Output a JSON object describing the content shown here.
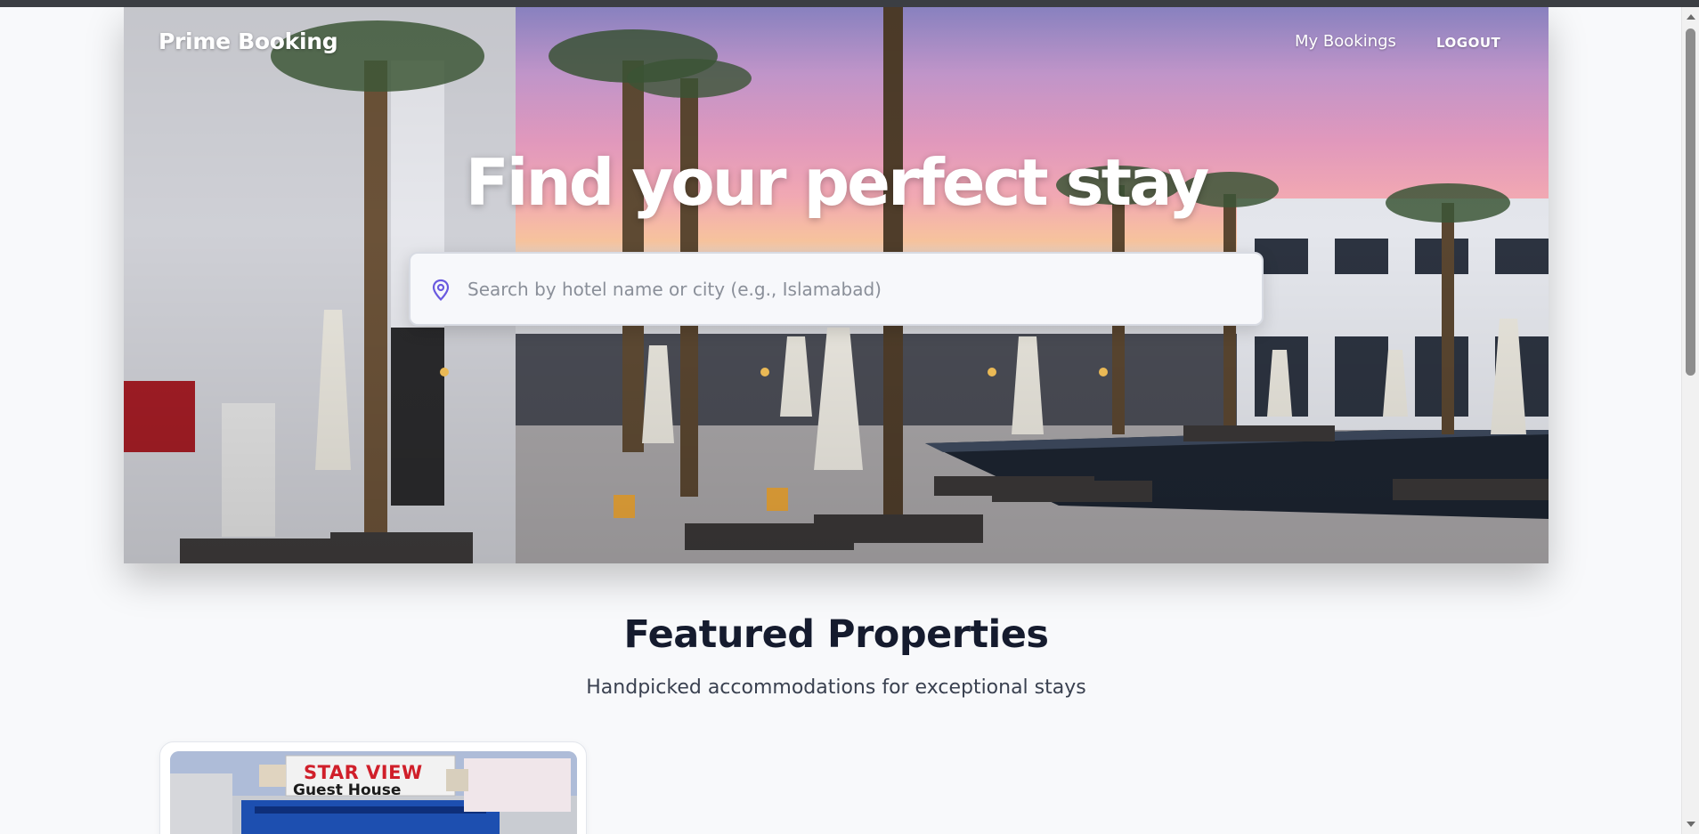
{
  "header": {
    "brand": "Prime Booking",
    "nav_my_bookings": "My Bookings",
    "nav_logout": "LOGOUT"
  },
  "hero": {
    "title": "Find your perfect stay",
    "search_placeholder": "Search by hotel name or city (e.g., Islamabad)",
    "search_value": "",
    "search_icon": "map-pin-icon"
  },
  "featured": {
    "title": "Featured Properties",
    "subtitle": "Handpicked accommodations for exceptional stays",
    "cards": [
      {
        "sign_title": "STAR VIEW",
        "sign_subtitle": "Guest House"
      }
    ]
  },
  "colors": {
    "accent": "#6a5ae0",
    "heading": "#151b2e",
    "background": "#f8f9fb"
  }
}
